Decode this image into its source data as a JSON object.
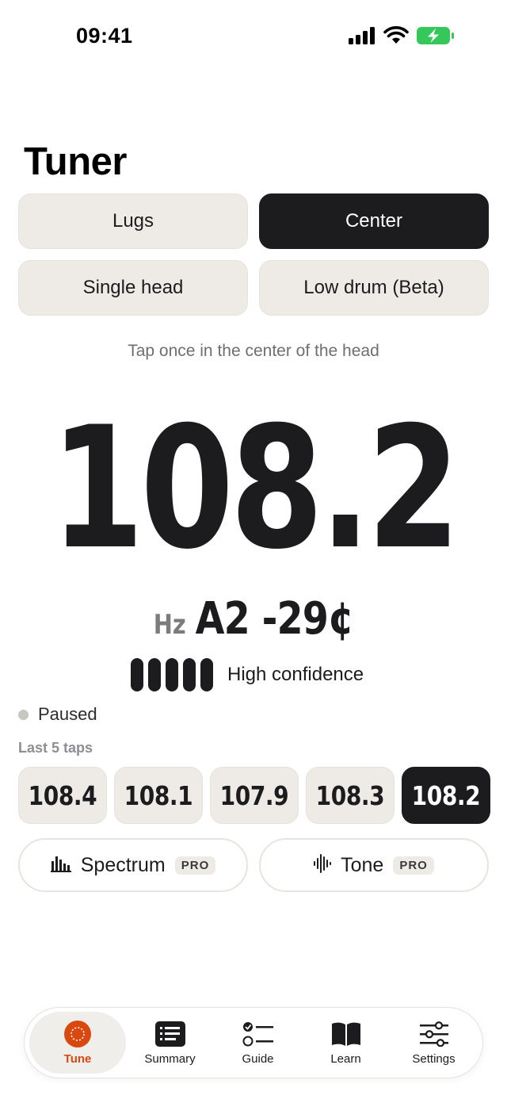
{
  "status_bar": {
    "time": "09:41",
    "icons": [
      "signal-icon",
      "wifi-icon",
      "battery-charging-icon"
    ]
  },
  "page": {
    "title": "Tuner"
  },
  "modes": [
    {
      "label": "Lugs",
      "selected": false
    },
    {
      "label": "Center",
      "selected": true
    },
    {
      "label": "Single head",
      "selected": false
    },
    {
      "label": "Low drum (Beta)",
      "selected": false
    }
  ],
  "hint": "Tap once in the center of the head",
  "reading": {
    "frequency": "108.2",
    "unit": "Hz",
    "note": "A2 -29¢",
    "confidence_label": "High confidence",
    "confidence_level": 5,
    "confidence_max": 5
  },
  "status": {
    "label": "Paused"
  },
  "taps": {
    "label": "Last 5 taps",
    "values": [
      "108.4",
      "108.1",
      "107.9",
      "108.3",
      "108.2"
    ],
    "selected_index": 4
  },
  "features": [
    {
      "label": "Spectrum",
      "badge": "PRO",
      "icon": "spectrum-icon"
    },
    {
      "label": "Tone",
      "badge": "PRO",
      "icon": "waveform-icon"
    }
  ],
  "tabs": [
    {
      "label": "Tune",
      "icon": "tuner-icon",
      "active": true
    },
    {
      "label": "Summary",
      "icon": "summary-icon",
      "active": false
    },
    {
      "label": "Guide",
      "icon": "checklist-icon",
      "active": false
    },
    {
      "label": "Learn",
      "icon": "book-icon",
      "active": false
    },
    {
      "label": "Settings",
      "icon": "sliders-icon",
      "active": false
    }
  ],
  "colors": {
    "accent": "#d9480f",
    "chip_bg": "#eeebe6",
    "dark": "#1c1c1e",
    "battery": "#34c759"
  }
}
